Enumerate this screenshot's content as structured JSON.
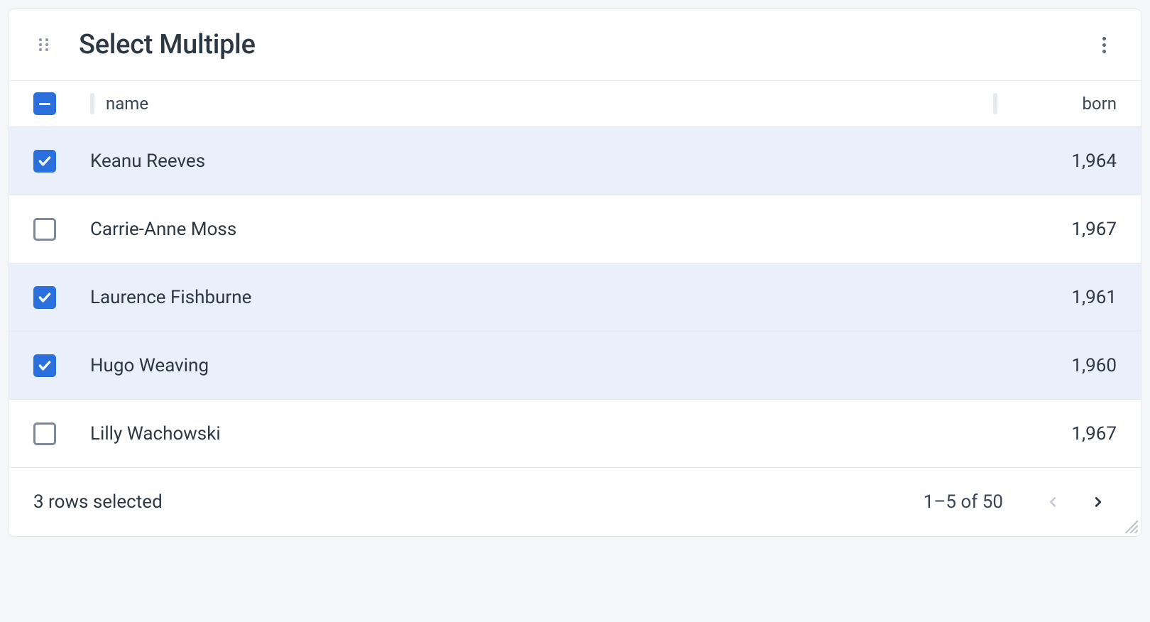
{
  "header": {
    "title": "Select Multiple"
  },
  "columns": {
    "name_label": "name",
    "born_label": "born"
  },
  "rows": [
    {
      "name": "Keanu Reeves",
      "born": "1,964",
      "selected": true
    },
    {
      "name": "Carrie-Anne Moss",
      "born": "1,967",
      "selected": false
    },
    {
      "name": "Laurence Fishburne",
      "born": "1,961",
      "selected": true
    },
    {
      "name": "Hugo Weaving",
      "born": "1,960",
      "selected": true
    },
    {
      "name": "Lilly Wachowski",
      "born": "1,967",
      "selected": false
    }
  ],
  "footer": {
    "status": "3 rows selected",
    "range": "1–5 of 50",
    "prev_disabled": true,
    "next_disabled": false
  },
  "header_checkbox_state": "indeterminate"
}
